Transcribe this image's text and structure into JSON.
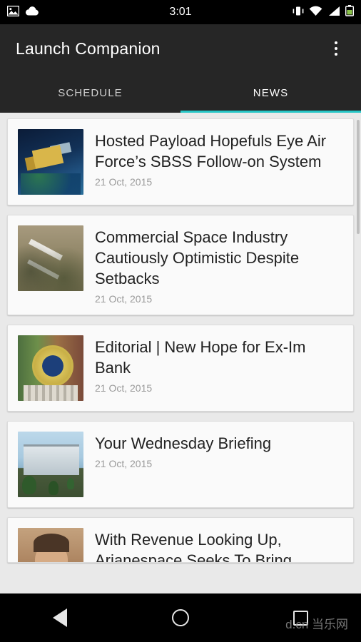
{
  "status_bar": {
    "time": "3:01",
    "left_icons": [
      "image-icon",
      "cloud-upload-icon"
    ],
    "right_icons": [
      "vibrate-icon",
      "wifi-icon",
      "signal-icon",
      "battery-icon"
    ]
  },
  "app_bar": {
    "title": "Launch Companion",
    "overflow_label": "More options"
  },
  "tabs": {
    "items": [
      {
        "label": "SCHEDULE",
        "active": false
      },
      {
        "label": "NEWS",
        "active": true
      }
    ],
    "indicator_color": "#26c6c6"
  },
  "news": {
    "items": [
      {
        "headline": "Hosted Payload Hopefuls Eye Air Force’s SBSS Follow-on System",
        "date": "21 Oct, 2015",
        "thumb": "satellite-thumbnail"
      },
      {
        "headline": "Commercial Space Industry Cautiously Optimistic Despite Setbacks",
        "date": "21 Oct, 2015",
        "thumb": "desert-wreckage-thumbnail"
      },
      {
        "headline": "Editorial | New Hope for Ex-Im Bank",
        "date": "21 Oct, 2015",
        "thumb": "government-seal-thumbnail"
      },
      {
        "headline": "Your Wednesday Briefing",
        "date": "21 Oct, 2015",
        "thumb": "spacex-building-thumbnail"
      },
      {
        "headline": "With Revenue Looking Up, Arianespace Seeks To Bring",
        "date": "",
        "thumb": "portrait-thumbnail"
      }
    ]
  },
  "nav_bar": {
    "back_label": "Back",
    "home_label": "Home",
    "recents_label": "Recent apps",
    "watermark": "d.cn 当乐网"
  }
}
